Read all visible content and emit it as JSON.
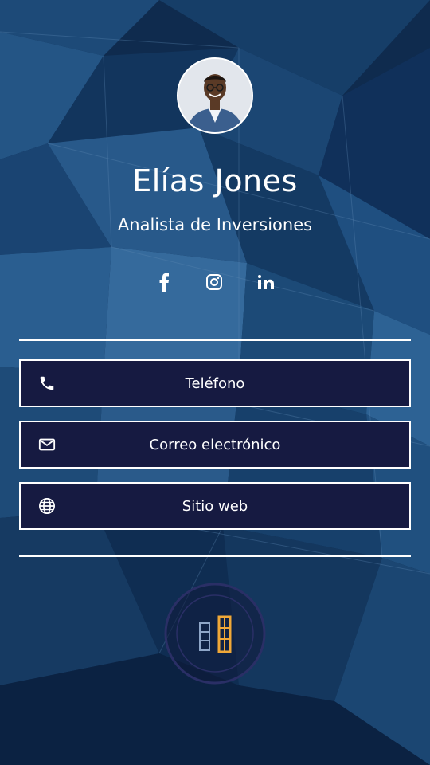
{
  "profile": {
    "name": "Elías Jones",
    "role": "Analista de Inversiones"
  },
  "social": [
    {
      "network": "facebook",
      "icon": "facebook-icon"
    },
    {
      "network": "instagram",
      "icon": "instagram-icon"
    },
    {
      "network": "linkedin",
      "icon": "linkedin-icon"
    }
  ],
  "contact": {
    "phone_label": "Teléfono",
    "email_label": "Correo electrónico",
    "website_label": "Sitio web"
  },
  "colors": {
    "background": "#0e2a4c",
    "button_fill": "#161a41",
    "border": "#ffffff",
    "logo_accent": "#f0a838"
  }
}
